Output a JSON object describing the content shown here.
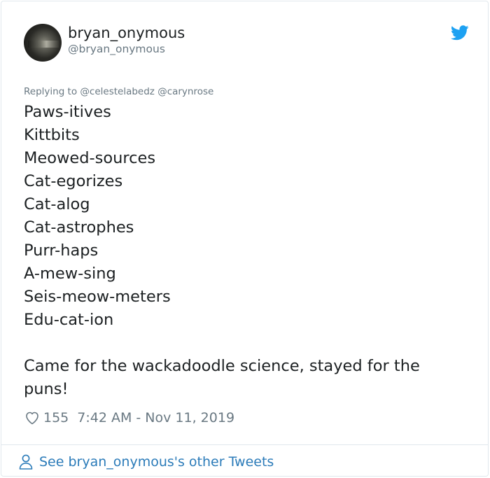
{
  "author": {
    "display_name": "bryan_onymous",
    "handle": "@bryan_onymous"
  },
  "reply": {
    "prefix": "Replying to",
    "mentions": [
      "@celestelabedz",
      "@carynrose"
    ]
  },
  "tweet": {
    "lines": [
      "Paws-itives",
      "Kittbits",
      "Meowed-sources",
      "Cat-egorizes",
      "Cat-alog",
      "Cat-astrophes",
      "Purr-haps",
      "A-mew-sing",
      "Seis-meow-meters",
      "Edu-cat-ion"
    ],
    "closing": "Came for the wackadoodle science, stayed for the puns!"
  },
  "meta": {
    "likes": "155",
    "timestamp": "7:42 AM - Nov 11, 2019"
  },
  "footer": {
    "see_more_label": "See bryan_onymous's other Tweets"
  },
  "icons": {
    "brand": "twitter-bird-icon",
    "like": "heart-icon",
    "profile": "person-icon"
  },
  "colors": {
    "brand_blue": "#1da1f2",
    "link_blue": "#2b7bb9",
    "text": "#1c2022",
    "muted": "#697882",
    "border": "#e1e8ed"
  }
}
